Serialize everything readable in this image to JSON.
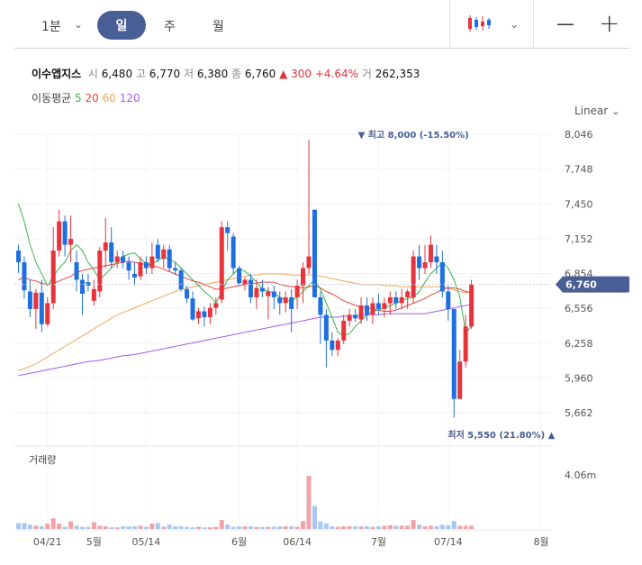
{
  "toolbar": {
    "interval": "1분",
    "tabs": [
      "일",
      "주",
      "월"
    ],
    "active_tab": "일",
    "chart_style_icon": "candlestick-icon",
    "zoom_out": "—",
    "zoom_in": "+"
  },
  "stock": {
    "name": "이수앱지스",
    "open_label": "시",
    "open": "6,480",
    "high_label": "고",
    "high": "6,770",
    "low_label": "저",
    "low": "6,380",
    "close_label": "종",
    "close": "6,760",
    "change": "▲ 300",
    "change_pct": "+4.64%",
    "volume_label": "거",
    "volume": "262,353"
  },
  "ma": {
    "label": "이동평균",
    "periods": [
      "5",
      "20",
      "60",
      "120"
    ],
    "colors": [
      "#3cb44b",
      "#e8453c",
      "#f3a65a",
      "#a55de8"
    ]
  },
  "scale_mode": "Linear",
  "colors": {
    "up": "#e8333c",
    "down": "#1f6fe0",
    "badge": "#4a5e96",
    "up_text": "#e0313b"
  },
  "chart_data": {
    "type": "candlestick",
    "y_ticks": [
      5662,
      5960,
      6258,
      6556,
      6854,
      7152,
      7450,
      7748,
      8046
    ],
    "y_tick_labels": [
      "5,662",
      "5,960",
      "6,258",
      "6,556",
      "6,854",
      "7,152",
      "7,450",
      "7,748",
      "8,046"
    ],
    "ylim": [
      5550,
      8080
    ],
    "x_labels": [
      "04/21",
      "5월",
      "05/14",
      "6월",
      "06/14",
      "7월",
      "07/14",
      "8월"
    ],
    "x_label_index": [
      5,
      13,
      22,
      38,
      48,
      62,
      74,
      90
    ],
    "current_price": 6760,
    "current_price_label": "6,760",
    "max_label": "▼ 최고 8,000 (-15.50%)",
    "min_label": "최저 5,550 (21.80%) ▲",
    "max_index": 58,
    "min_index": 93,
    "volume_title": "거래량",
    "volume_tick": "4.06m",
    "volume_tick_value": 4060000,
    "candles": [
      [
        7050,
        7100,
        6860,
        6950
      ],
      [
        6950,
        7000,
        6640,
        6710
      ],
      [
        6700,
        6800,
        6480,
        6550
      ],
      [
        6550,
        6720,
        6380,
        6690
      ],
      [
        6690,
        6800,
        6350,
        6420
      ],
      [
        6420,
        6650,
        6400,
        6600
      ],
      [
        6600,
        7250,
        6550,
        7050
      ],
      [
        7050,
        7400,
        7000,
        7300
      ],
      [
        7300,
        7350,
        7000,
        7100
      ],
      [
        7100,
        7350,
        6950,
        7150
      ],
      [
        6950,
        7050,
        6700,
        6800
      ],
      [
        6800,
        6850,
        6500,
        6680
      ],
      [
        6780,
        6850,
        6700,
        6750
      ],
      [
        6620,
        6800,
        6580,
        6720
      ],
      [
        6700,
        7080,
        6650,
        7050
      ],
      [
        7050,
        7330,
        6900,
        7120
      ],
      [
        7120,
        7250,
        6900,
        6950
      ],
      [
        6950,
        7050,
        6900,
        7000
      ],
      [
        7000,
        7050,
        6900,
        6950
      ],
      [
        6950,
        7000,
        6800,
        6880
      ],
      [
        6850,
        6950,
        6750,
        6820
      ],
      [
        6830,
        7000,
        6800,
        6950
      ],
      [
        6950,
        7000,
        6850,
        6900
      ],
      [
        6900,
        7120,
        6850,
        7000
      ],
      [
        7100,
        7150,
        6950,
        6980
      ],
      [
        6980,
        7100,
        6900,
        7060
      ],
      [
        7060,
        7100,
        6870,
        6900
      ],
      [
        6900,
        6950,
        6840,
        6880
      ],
      [
        6880,
        6900,
        6700,
        6720
      ],
      [
        6720,
        6750,
        6600,
        6640
      ],
      [
        6640,
        6700,
        6450,
        6460
      ],
      [
        6470,
        6560,
        6420,
        6530
      ],
      [
        6530,
        6570,
        6400,
        6480
      ],
      [
        6480,
        6600,
        6420,
        6560
      ],
      [
        6560,
        6650,
        6500,
        6600
      ],
      [
        6630,
        7300,
        6600,
        7250
      ],
      [
        7250,
        7300,
        7050,
        7200
      ],
      [
        7170,
        7200,
        6850,
        6900
      ],
      [
        6900,
        6920,
        6750,
        6770
      ],
      [
        6760,
        6820,
        6710,
        6800
      ],
      [
        6800,
        6850,
        6600,
        6650
      ],
      [
        6650,
        6800,
        6550,
        6730
      ],
      [
        6730,
        6800,
        6650,
        6700
      ],
      [
        6660,
        6740,
        6460,
        6700
      ],
      [
        6700,
        6750,
        6550,
        6650
      ],
      [
        6650,
        6700,
        6500,
        6600
      ],
      [
        6600,
        6700,
        6520,
        6650
      ],
      [
        6650,
        6720,
        6350,
        6550
      ],
      [
        6650,
        6800,
        6550,
        6750
      ],
      [
        6750,
        6950,
        6600,
        6900
      ],
      [
        6900,
        8000,
        6850,
        7000
      ],
      [
        7400,
        7400,
        6800,
        6650
      ],
      [
        6650,
        6700,
        6250,
        6500
      ],
      [
        6500,
        6550,
        6050,
        6280
      ],
      [
        6280,
        6350,
        6150,
        6200
      ],
      [
        6200,
        6300,
        6150,
        6280
      ],
      [
        6280,
        6500,
        6250,
        6450
      ],
      [
        6450,
        6550,
        6400,
        6500
      ],
      [
        6500,
        6550,
        6440,
        6470
      ],
      [
        6460,
        6650,
        6420,
        6580
      ],
      [
        6580,
        6650,
        6450,
        6500
      ],
      [
        6500,
        6650,
        6420,
        6600
      ],
      [
        6600,
        6680,
        6500,
        6550
      ],
      [
        6550,
        6650,
        6480,
        6600
      ],
      [
        6600,
        6700,
        6500,
        6650
      ],
      [
        6650,
        6700,
        6550,
        6600
      ],
      [
        6600,
        6720,
        6550,
        6650
      ],
      [
        6650,
        6720,
        6550,
        6700
      ],
      [
        6650,
        7050,
        6600,
        7000
      ],
      [
        7000,
        7100,
        6800,
        6900
      ],
      [
        6900,
        7100,
        6850,
        6950
      ],
      [
        6950,
        7180,
        6900,
        7100
      ],
      [
        7000,
        7100,
        6850,
        6950
      ],
      [
        6950,
        7050,
        6650,
        6700
      ],
      [
        6700,
        6750,
        6450,
        6550
      ],
      [
        6550,
        6550,
        5620,
        5780
      ],
      [
        5780,
        6200,
        5780,
        6100
      ],
      [
        6100,
        6500,
        6050,
        6400
      ],
      [
        6400,
        6800,
        6380,
        6760
      ]
    ],
    "volumes": [
      0.11,
      0.11,
      0.08,
      0.06,
      0.05,
      0.1,
      0.2,
      0.1,
      0.04,
      0.14,
      0.06,
      0.04,
      0.04,
      0.13,
      0.06,
      0.05,
      0.03,
      0.03,
      0.05,
      0.05,
      0.05,
      0.06,
      0.04,
      0.1,
      0.11,
      0.04,
      0.08,
      0.05,
      0.05,
      0.04,
      0.03,
      0.04,
      0.03,
      0.03,
      0.04,
      0.17,
      0.08,
      0.04,
      0.05,
      0.05,
      0.05,
      0.04,
      0.04,
      0.04,
      0.04,
      0.05,
      0.05,
      0.05,
      0.04,
      0.15,
      1.0,
      0.43,
      0.14,
      0.1,
      0.05,
      0.04,
      0.05,
      0.05,
      0.05,
      0.05,
      0.05,
      0.04,
      0.05,
      0.06,
      0.07,
      0.06,
      0.06,
      0.06,
      0.17,
      0.08,
      0.05,
      0.06,
      0.05,
      0.08,
      0.07,
      0.15,
      0.06,
      0.06,
      0.06
    ],
    "ma5": [
      7450,
      7300,
      7100,
      6950,
      6850,
      6750,
      6830,
      6900,
      6950,
      7050,
      7100,
      7050,
      6950,
      6880,
      6800,
      6850,
      6900,
      6950,
      7000,
      7020,
      7030,
      6980,
      6940,
      6930,
      6970,
      6990,
      6980,
      6950,
      6900,
      6850,
      6800,
      6750,
      6700,
      6660,
      6600,
      6700,
      6800,
      6850,
      6900,
      6870,
      6830,
      6780,
      6720,
      6700,
      6690,
      6650,
      6620,
      6620,
      6650,
      6700,
      6750,
      6800,
      6720,
      6600,
      6480,
      6350,
      6320,
      6340,
      6400,
      6450,
      6500,
      6530,
      6540,
      6560,
      6580,
      6600,
      6620,
      6640,
      6650,
      6700,
      6780,
      6850,
      6900,
      6950,
      6900,
      6800,
      6650,
      6350,
      6400
    ],
    "ma20": [
      6800,
      6820,
      6800,
      6790,
      6770,
      6760,
      6770,
      6790,
      6810,
      6830,
      6860,
      6880,
      6890,
      6900,
      6910,
      6920,
      6930,
      6940,
      6950,
      6960,
      6950,
      6940,
      6930,
      6920,
      6910,
      6890,
      6870,
      6850,
      6830,
      6810,
      6790,
      6780,
      6760,
      6740,
      6720,
      6720,
      6730,
      6740,
      6750,
      6760,
      6770,
      6770,
      6780,
      6780,
      6780,
      6760,
      6750,
      6740,
      6740,
      6730,
      6740,
      6750,
      6730,
      6700,
      6680,
      6650,
      6620,
      6600,
      6580,
      6570,
      6560,
      6550,
      6540,
      6530,
      6530,
      6540,
      6560,
      6580,
      6600,
      6620,
      6640,
      6670,
      6690,
      6720,
      6730,
      6730,
      6720,
      6700,
      6690
    ],
    "ma60": [
      6020,
      6040,
      6060,
      6080,
      6110,
      6140,
      6170,
      6200,
      6230,
      6260,
      6290,
      6320,
      6350,
      6380,
      6410,
      6440,
      6470,
      6500,
      6520,
      6540,
      6560,
      6580,
      6600,
      6620,
      6640,
      6660,
      6680,
      6700,
      6720,
      6730,
      6740,
      6750,
      6760,
      6770,
      6780,
      6790,
      6800,
      6810,
      6820,
      6830,
      6840,
      6840,
      6850,
      6850,
      6850,
      6850,
      6850,
      6840,
      6840,
      6840,
      6840,
      6840,
      6830,
      6820,
      6810,
      6800,
      6790,
      6780,
      6770,
      6760,
      6760,
      6760,
      6760,
      6750,
      6750,
      6750,
      6740,
      6740,
      6740,
      6740,
      6740,
      6740,
      6740,
      6740,
      6730,
      6710,
      6700,
      6690,
      6700
    ],
    "ma120": [
      5980,
      5990,
      6000,
      6010,
      6020,
      6030,
      6040,
      6050,
      6060,
      6070,
      6080,
      6090,
      6100,
      6105,
      6110,
      6120,
      6130,
      6140,
      6150,
      6155,
      6160,
      6170,
      6180,
      6190,
      6200,
      6210,
      6220,
      6230,
      6240,
      6250,
      6260,
      6270,
      6280,
      6290,
      6300,
      6310,
      6320,
      6330,
      6340,
      6350,
      6360,
      6370,
      6380,
      6390,
      6400,
      6410,
      6420,
      6430,
      6440,
      6450,
      6460,
      6470,
      6480,
      6480,
      6480,
      6480,
      6490,
      6490,
      6490,
      6500,
      6500,
      6500,
      6500,
      6510,
      6510,
      6510,
      6510,
      6510,
      6510,
      6510,
      6510,
      6520,
      6530,
      6540,
      6550,
      6560,
      6570,
      6580,
      6590
    ]
  }
}
